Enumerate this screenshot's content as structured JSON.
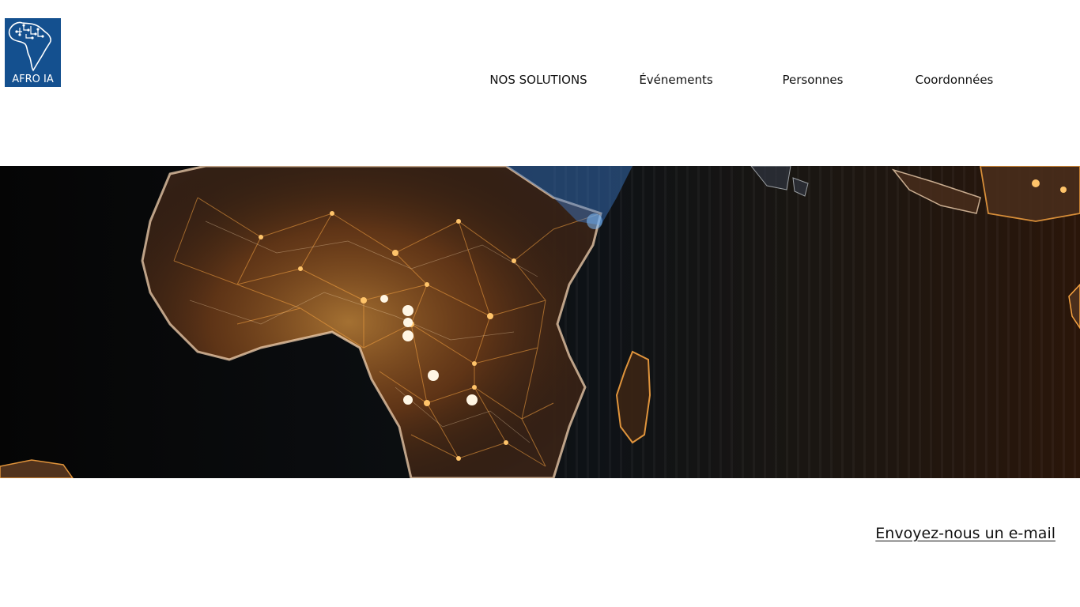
{
  "header": {
    "logo_text": "AFRO IA",
    "logo_icon": "africa-circuit-logo-icon"
  },
  "nav": {
    "items": [
      {
        "label": "NOS SOLUTIONS"
      },
      {
        "label": "Événements"
      },
      {
        "label": "Personnes"
      },
      {
        "label": "Coordonnées"
      }
    ]
  },
  "hero": {
    "image": "glowing-africa-network-map"
  },
  "contact": {
    "email_link": "Envoyez-nous un e-mail"
  },
  "colors": {
    "logo_background": "#14508f",
    "hero_glow": "#f08a24",
    "hero_background": "#0a0706"
  }
}
